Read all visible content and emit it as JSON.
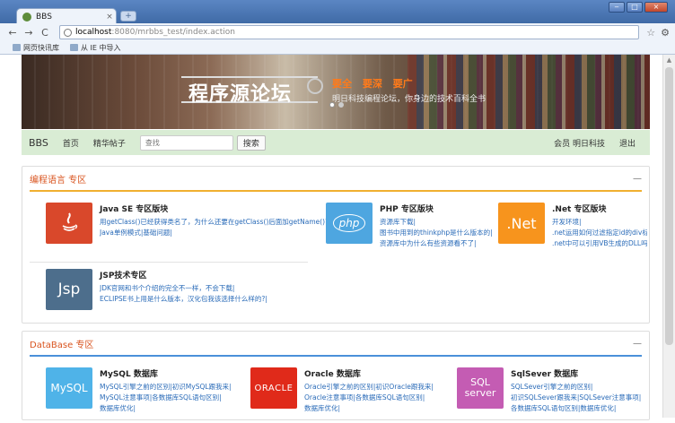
{
  "browser": {
    "tab_title": "BBS",
    "tab_close": "×",
    "new_tab": "+",
    "url_host": "localhost",
    "url_path": ":8080/mrbbs_test/index.action",
    "back": "←",
    "forward": "→",
    "reload": "C",
    "star": "☆",
    "wrench": "🔧",
    "bookmarks": [
      "网页快讯库",
      "从 IE 中导入"
    ]
  },
  "banner": {
    "title": "程序源论坛",
    "slogan": [
      "要全",
      "要深",
      "要广"
    ],
    "subtitle": "明日科技编程论坛，你身边的技术百科全书"
  },
  "navbar": {
    "brand": "BBS",
    "links": [
      "首页",
      "精华帖子"
    ],
    "search_placeholder": "查找",
    "search_button": "搜索",
    "right": [
      "会员 明日科技",
      "退出"
    ]
  },
  "sections": [
    {
      "title": "编程语言 专区",
      "collapse": "—",
      "accent": "#f0b030",
      "forums": [
        {
          "icon": "java-icon",
          "label": "",
          "color": "#d9482b",
          "name": "Java SE 专区版块",
          "lines": [
            "用getClass()已经获得类名了，为什么还要在getClass()后面加getName()?|",
            "Java单例模式|基础问题|"
          ]
        },
        {
          "icon": "php-icon",
          "label": "php",
          "color": "#4ea6e0",
          "name": "PHP 专区版块",
          "lines": [
            "资源库下载|",
            "图书中用到的thinkphp是什么版本的|",
            "资源库中为什么有些资源看不了|"
          ]
        },
        {
          "icon": "net-icon",
          "label": ".Net",
          "color": "#f7941d",
          "name": ".Net 专区版块",
          "lines": [
            "开发环境|",
            ".net运用如何过滤指定id的div标签|",
            ".net中可以引用VB生成的DLL吗?|"
          ]
        },
        {
          "icon": "jsp-icon",
          "label": "Jsp",
          "color": "#4d6e8c",
          "name": "JSP技术专区",
          "lines": [
            "JDK官网和书个介绍的完全不一样，不会下载|",
            "ECLIPSE书上用是什么版本，汉化包我该选择什么样的?|"
          ]
        }
      ]
    },
    {
      "title": "DataBase 专区",
      "collapse": "—",
      "accent": "#4a90d9",
      "forums": [
        {
          "icon": "mysql-icon",
          "label": "MySQL",
          "color": "#4fb3e8",
          "name": "MySQL 数据库",
          "lines": [
            "MySQL引擎之前的区别|初识MySQL跟我来|",
            "MySQL注意事项|各数据库SQL语句区别|",
            "数据库优化|"
          ]
        },
        {
          "icon": "oracle-icon",
          "label": "ORACLE",
          "color": "#e02a1a",
          "name": "Oracle 数据库",
          "lines": [
            "Oracle引擎之前的区别|初识Oracle跟我来|",
            "Oracle注意事项|各数据库SQL语句区别|",
            "数据库优化|"
          ]
        },
        {
          "icon": "sqlserver-icon",
          "label": "SQL server",
          "color": "#c45cb3",
          "name": "SqlSever 数据库",
          "lines": [
            "SQLSever引擎之前的区别|",
            "初识SQLSever跟我来|SQLSever注意事项|",
            "各数据库SQL语句区别|数据库优化|"
          ]
        }
      ]
    }
  ]
}
